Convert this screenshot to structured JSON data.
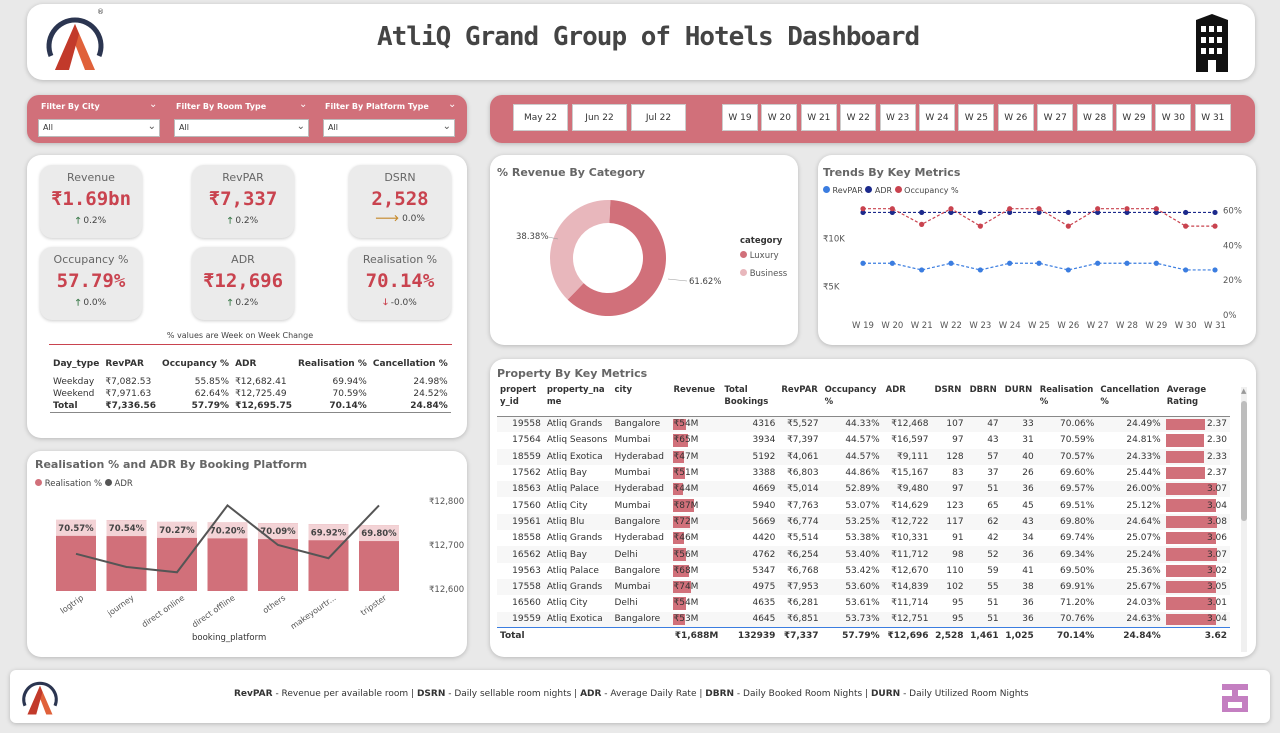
{
  "header": {
    "title": "AtliQ Grand Group of Hotels Dashboard",
    "logo_text": "A"
  },
  "filters": [
    {
      "label": "Filter By City",
      "value": "All"
    },
    {
      "label": "Filter By Room Type",
      "value": "All"
    },
    {
      "label": "Filter By Platform Type",
      "value": "All"
    }
  ],
  "months": [
    "May 22",
    "Jun 22",
    "Jul 22"
  ],
  "weeks": [
    "W 19",
    "W 20",
    "W 21",
    "W 22",
    "W 23",
    "W 24",
    "W 25",
    "W 26",
    "W 27",
    "W 28",
    "W 29",
    "W 30",
    "W 31"
  ],
  "kpis": [
    {
      "label": "Revenue",
      "value": "₹1.69bn",
      "change": "0.2%",
      "dir": "up"
    },
    {
      "label": "RevPAR",
      "value": "₹7,337",
      "change": "0.2%",
      "dir": "up"
    },
    {
      "label": "DSRN",
      "value": "2,528",
      "change": "0.0%",
      "dir": "flat"
    },
    {
      "label": "Occupancy %",
      "value": "57.79%",
      "change": "0.0%",
      "dir": "up"
    },
    {
      "label": "ADR",
      "value": "₹12,696",
      "change": "0.2%",
      "dir": "up"
    },
    {
      "label": "Realisation %",
      "value": "70.14%",
      "change": "-0.0%",
      "dir": "down"
    }
  ],
  "kpi_note": "% values are Week on Week Change",
  "day_table": {
    "headers": [
      "Day_type",
      "RevPAR",
      "Occupancy %",
      "ADR",
      "Realisation %",
      "Cancellation %"
    ],
    "rows": [
      [
        "Weekday",
        "₹7,082.53",
        "55.85%",
        "₹12,682.41",
        "69.94%",
        "24.98%"
      ],
      [
        "Weekend",
        "₹7,971.63",
        "62.64%",
        "₹12,725.49",
        "70.59%",
        "24.52%"
      ]
    ],
    "total": [
      "Total",
      "₹7,336.56",
      "57.79%",
      "₹12,695.75",
      "70.14%",
      "24.84%"
    ]
  },
  "donut": {
    "title": "% Revenue By Category",
    "legend_title": "category",
    "items": [
      {
        "name": "Luxury",
        "pct": 61.62,
        "label": "61.62%",
        "color": "#d1707a"
      },
      {
        "name": "Business",
        "pct": 38.38,
        "label": "38.38%",
        "color": "#e8b7bc"
      }
    ]
  },
  "trends": {
    "title": "Trends By Key Metrics",
    "legend": [
      {
        "name": "RevPAR",
        "color": "#3b7de0"
      },
      {
        "name": "ADR",
        "color": "#1c2a8c"
      },
      {
        "name": "Occupancy %",
        "color": "#c9434f"
      }
    ],
    "y_left": [
      "₹10K",
      "₹5K"
    ],
    "y_right": [
      "60%",
      "40%",
      "20%",
      "0%"
    ]
  },
  "booking": {
    "title": "Realisation % and ADR By Booking Platform",
    "legend": [
      {
        "name": "Realisation %",
        "color": "#d1707a"
      },
      {
        "name": "ADR",
        "color": "#555555"
      }
    ],
    "xlabel": "booking_platform",
    "y_right": [
      "₹12,800",
      "₹12,700",
      "₹12,600"
    ]
  },
  "property": {
    "title": "Property By Key Metrics",
    "headers": [
      "propert y_id",
      "property_na me",
      "city",
      "Revenue",
      "Total Bookings",
      "RevPAR",
      "Occupancy %",
      "ADR",
      "DSRN",
      "DBRN",
      "DURN",
      "Realisation %",
      "Cancellation %",
      "Average Rating"
    ],
    "rows": [
      [
        "19558",
        "Atliq Grands",
        "Bangalore",
        "₹54M",
        "4316",
        "₹5,527",
        "44.33%",
        "₹12,468",
        "107",
        "47",
        "33",
        "70.06%",
        "24.49%",
        "2.37"
      ],
      [
        "17564",
        "Atliq Seasons",
        "Mumbai",
        "₹65M",
        "3934",
        "₹7,397",
        "44.57%",
        "₹16,597",
        "97",
        "43",
        "31",
        "70.59%",
        "24.81%",
        "2.30"
      ],
      [
        "18559",
        "Atliq Exotica",
        "Hyderabad",
        "₹47M",
        "5192",
        "₹4,061",
        "44.57%",
        "₹9,111",
        "128",
        "57",
        "40",
        "70.57%",
        "24.33%",
        "2.33"
      ],
      [
        "17562",
        "Atliq Bay",
        "Mumbai",
        "₹51M",
        "3388",
        "₹6,803",
        "44.86%",
        "₹15,167",
        "83",
        "37",
        "26",
        "69.60%",
        "25.44%",
        "2.37"
      ],
      [
        "18563",
        "Atliq Palace",
        "Hyderabad",
        "₹44M",
        "4669",
        "₹5,014",
        "52.89%",
        "₹9,480",
        "97",
        "51",
        "36",
        "69.57%",
        "26.00%",
        "3.07"
      ],
      [
        "17560",
        "Atliq City",
        "Mumbai",
        "₹87M",
        "5940",
        "₹7,763",
        "53.07%",
        "₹14,629",
        "123",
        "65",
        "45",
        "69.51%",
        "25.12%",
        "3.04"
      ],
      [
        "19561",
        "Atliq Blu",
        "Bangalore",
        "₹72M",
        "5669",
        "₹6,774",
        "53.25%",
        "₹12,722",
        "117",
        "62",
        "43",
        "69.80%",
        "24.64%",
        "3.08"
      ],
      [
        "18558",
        "Atliq Grands",
        "Hyderabad",
        "₹46M",
        "4420",
        "₹5,514",
        "53.38%",
        "₹10,331",
        "91",
        "42",
        "34",
        "69.74%",
        "25.07%",
        "3.06"
      ],
      [
        "16562",
        "Atliq Bay",
        "Delhi",
        "₹56M",
        "4762",
        "₹6,254",
        "53.40%",
        "₹11,712",
        "98",
        "52",
        "36",
        "69.34%",
        "25.24%",
        "3.07"
      ],
      [
        "19563",
        "Atliq Palace",
        "Bangalore",
        "₹68M",
        "5347",
        "₹6,768",
        "53.42%",
        "₹12,670",
        "110",
        "59",
        "41",
        "69.50%",
        "25.36%",
        "3.02"
      ],
      [
        "17558",
        "Atliq Grands",
        "Mumbai",
        "₹74M",
        "4975",
        "₹7,953",
        "53.60%",
        "₹14,839",
        "102",
        "55",
        "38",
        "69.91%",
        "25.67%",
        "3.05"
      ],
      [
        "16560",
        "Atliq City",
        "Delhi",
        "₹54M",
        "4635",
        "₹6,281",
        "53.61%",
        "₹11,714",
        "95",
        "51",
        "36",
        "71.20%",
        "24.03%",
        "3.01"
      ],
      [
        "19559",
        "Atliq Exotica",
        "Bangalore",
        "₹53M",
        "4645",
        "₹6,851",
        "53.73%",
        "₹12,751",
        "95",
        "51",
        "36",
        "70.76%",
        "24.63%",
        "3.04"
      ]
    ],
    "total": [
      "Total",
      "",
      "",
      "₹1,688M",
      "132939",
      "₹7,337",
      "57.79%",
      "₹12,696",
      "2,528",
      "1,461",
      "1,025",
      "70.14%",
      "24.84%",
      "3.62"
    ]
  },
  "footer": {
    "segments": [
      {
        "term": "RevPAR",
        "desc": " - Revenue per available room | "
      },
      {
        "term": "DSRN",
        "desc": " - Daily sellable room nights | "
      },
      {
        "term": "ADR",
        "desc": " - Average Daily Rate | "
      },
      {
        "term": "DBRN",
        "desc": " - Daily Booked Room Nights | "
      },
      {
        "term": "DURN",
        "desc": " - Daily Utilized Room Nights"
      }
    ]
  },
  "chart_data": [
    {
      "type": "pie",
      "title": "% Revenue By Category",
      "categories": [
        "Luxury",
        "Business"
      ],
      "values": [
        61.62,
        38.38
      ]
    },
    {
      "type": "line",
      "title": "Trends By Key Metrics",
      "x": [
        "W 19",
        "W 20",
        "W 21",
        "W 22",
        "W 23",
        "W 24",
        "W 25",
        "W 26",
        "W 27",
        "W 28",
        "W 29",
        "W 30",
        "W 31"
      ],
      "series": [
        {
          "name": "RevPAR",
          "axis": "left",
          "values": [
            7400,
            7400,
            6700,
            7400,
            6700,
            7400,
            7400,
            6700,
            7400,
            7400,
            7400,
            6700,
            6700
          ]
        },
        {
          "name": "ADR",
          "axis": "left",
          "values": [
            12700,
            12700,
            12700,
            12700,
            12700,
            12700,
            12700,
            12700,
            12700,
            12700,
            12700,
            12700,
            12700
          ]
        },
        {
          "name": "Occupancy %",
          "axis": "right",
          "values": [
            61,
            61,
            52,
            61,
            51,
            61,
            61,
            51,
            61,
            61,
            61,
            51,
            51
          ]
        }
      ],
      "ylim_left": [
        2000,
        14000
      ],
      "ylim_right": [
        0,
        66
      ]
    },
    {
      "type": "bar",
      "title": "Realisation % and ADR By Booking Platform",
      "categories": [
        "logtrip",
        "journey",
        "direct online",
        "direct offline",
        "others",
        "makeyourtr...",
        "tripster"
      ],
      "series": [
        {
          "name": "Realisation %",
          "values": [
            70.57,
            70.54,
            70.27,
            70.2,
            70.09,
            69.92,
            69.8
          ],
          "labels": [
            "70.57%",
            "70.54%",
            "70.27%",
            "70.20%",
            "70.09%",
            "69.92%",
            "69.80%"
          ]
        },
        {
          "name": "ADR",
          "axis": "right",
          "values": [
            12680,
            12650,
            12638,
            12790,
            12700,
            12670,
            12790
          ]
        }
      ],
      "xlabel": "booking_platform",
      "ylim_right": [
        12600,
        12800
      ]
    }
  ]
}
